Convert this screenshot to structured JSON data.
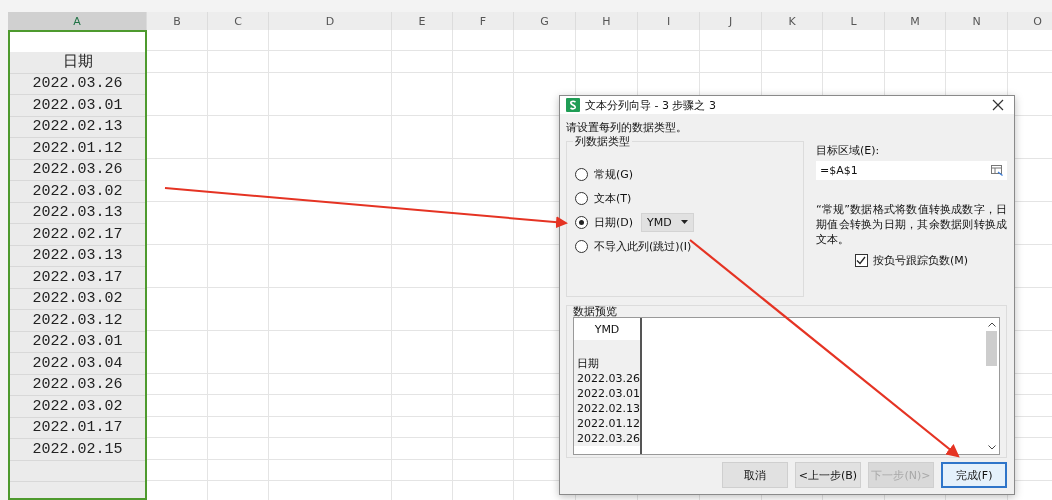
{
  "sheet": {
    "columns": [
      {
        "label": "A",
        "selected": true
      },
      {
        "label": "B",
        "selected": false
      },
      {
        "label": "C",
        "selected": false
      },
      {
        "label": "D",
        "selected": false
      },
      {
        "label": "E",
        "selected": false
      },
      {
        "label": "F",
        "selected": false
      },
      {
        "label": "G",
        "selected": false
      },
      {
        "label": "H",
        "selected": false
      },
      {
        "label": "I",
        "selected": false
      },
      {
        "label": "J",
        "selected": false
      },
      {
        "label": "K",
        "selected": false
      },
      {
        "label": "L",
        "selected": false
      },
      {
        "label": "M",
        "selected": false
      },
      {
        "label": "N",
        "selected": false
      },
      {
        "label": "O",
        "selected": false
      }
    ],
    "column_a": [
      "日期",
      "2022.03.26",
      "2022.03.01",
      "2022.02.13",
      "2022.01.12",
      "2022.03.26",
      "2022.03.02",
      "2022.03.13",
      "2022.02.17",
      "2022.03.13",
      "2022.03.17",
      "2022.03.02",
      "2022.03.12",
      "2022.03.01",
      "2022.03.04",
      "2022.03.26",
      "2022.03.02",
      "2022.01.17",
      "2022.02.15"
    ]
  },
  "dialog": {
    "title": "文本分列向导 - 3 步骤之 3",
    "instruction": "请设置每列的数据类型。",
    "group_label": "列数据类型",
    "options": [
      {
        "label": "常规(G)",
        "selected": false
      },
      {
        "label": "文本(T)",
        "selected": false
      },
      {
        "label": "日期(D)",
        "selected": true,
        "dropdown": "YMD"
      },
      {
        "label": "不导入此列(跳过)(I)",
        "selected": false
      }
    ],
    "target_label": "目标区域(E):",
    "target_value": "=$A$1",
    "note": "“常规”数据格式将数值转换成数字，日期值会转换为日期，其余数据则转换成文本。",
    "negative_checkbox": {
      "label": "按负号跟踪负数(M)",
      "checked": true
    },
    "preview_label": "数据预览",
    "preview_header": "YMD",
    "preview_rows": [
      "日期",
      "2022.03.26",
      "2022.03.01",
      "2022.02.13",
      "2022.01.12",
      "2022.03.26"
    ],
    "buttons": [
      {
        "label": "取消",
        "disabled": false,
        "default": false
      },
      {
        "label": "<上一步(B)",
        "disabled": false,
        "default": false
      },
      {
        "label": "下一步(N)>",
        "disabled": true,
        "default": false
      },
      {
        "label": "完成(F)",
        "disabled": false,
        "default": true
      }
    ]
  }
}
